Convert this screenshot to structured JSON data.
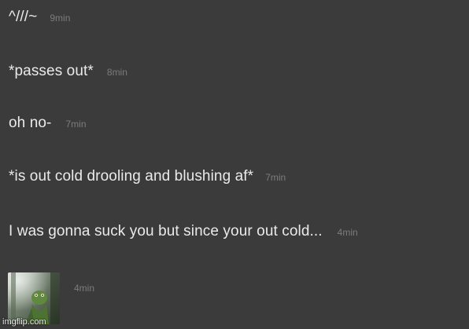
{
  "messages": [
    {
      "text": "^///~",
      "time": "9min"
    },
    {
      "text": "*passes out*",
      "time": "8min"
    },
    {
      "text": "oh no-",
      "time": "7min"
    },
    {
      "text": "*is out cold drooling and blushing af*",
      "time": "7min"
    },
    {
      "text": "I was gonna suck you but since your out cold...",
      "time": "4min"
    }
  ],
  "image_message": {
    "time": "4min"
  },
  "watermark": "imgflip.com"
}
